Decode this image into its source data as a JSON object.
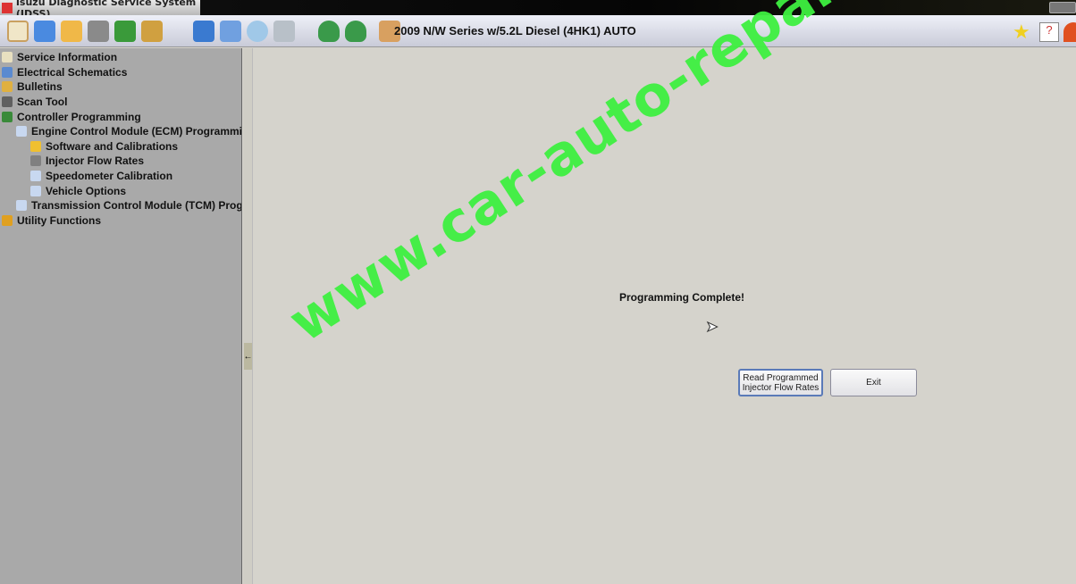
{
  "window": {
    "title": "Isuzu Diagnostic Service System (IDSS)",
    "logo": "IDSS"
  },
  "toolbar": {
    "icons": [
      "service-info-icon",
      "schematics-icon",
      "bulletins-icon",
      "scan-tool-icon",
      "controller-programming-icon",
      "utility-icon",
      "open-folder-icon",
      "monitor-icon",
      "search-icon",
      "print-icon",
      "green-light-icon",
      "green-light-icon",
      "notes-icon"
    ],
    "vehicle": "2009 N/W Series w/5.2L Diesel (4HK1) AUTO",
    "right_icons": [
      "favorites-star-icon",
      "help-icon",
      "home-icon"
    ]
  },
  "sidebar": {
    "items": [
      {
        "label": "Service Information",
        "level": 0,
        "icon": "#e8e0c0"
      },
      {
        "label": "Electrical Schematics",
        "level": 0,
        "icon": "#5a8ad0"
      },
      {
        "label": "Bulletins",
        "level": 0,
        "icon": "#e0b040"
      },
      {
        "label": "Scan Tool",
        "level": 0,
        "icon": "#606060"
      },
      {
        "label": "Controller Programming",
        "level": 0,
        "icon": "#3a8a3a"
      },
      {
        "label": "Engine Control Module (ECM) Programming",
        "level": 1,
        "icon": "#c8d8f0"
      },
      {
        "label": "Software and Calibrations",
        "level": 2,
        "icon": "#f0c030"
      },
      {
        "label": "Injector Flow Rates",
        "level": 2,
        "icon": "#808080"
      },
      {
        "label": "Speedometer Calibration",
        "level": 2,
        "icon": "#c8d8f0"
      },
      {
        "label": "Vehicle Options",
        "level": 2,
        "icon": "#c8d8f0"
      },
      {
        "label": "Transmission Control Module (TCM) Programming",
        "level": 1,
        "icon": "#c8d8f0"
      },
      {
        "label": "Utility Functions",
        "level": 0,
        "icon": "#e0a020"
      }
    ]
  },
  "main": {
    "message": "Programming Complete!",
    "read_button": "Read Programmed Injector Flow Rates",
    "exit_button": "Exit"
  },
  "watermark": "www.car-auto-repair.com"
}
